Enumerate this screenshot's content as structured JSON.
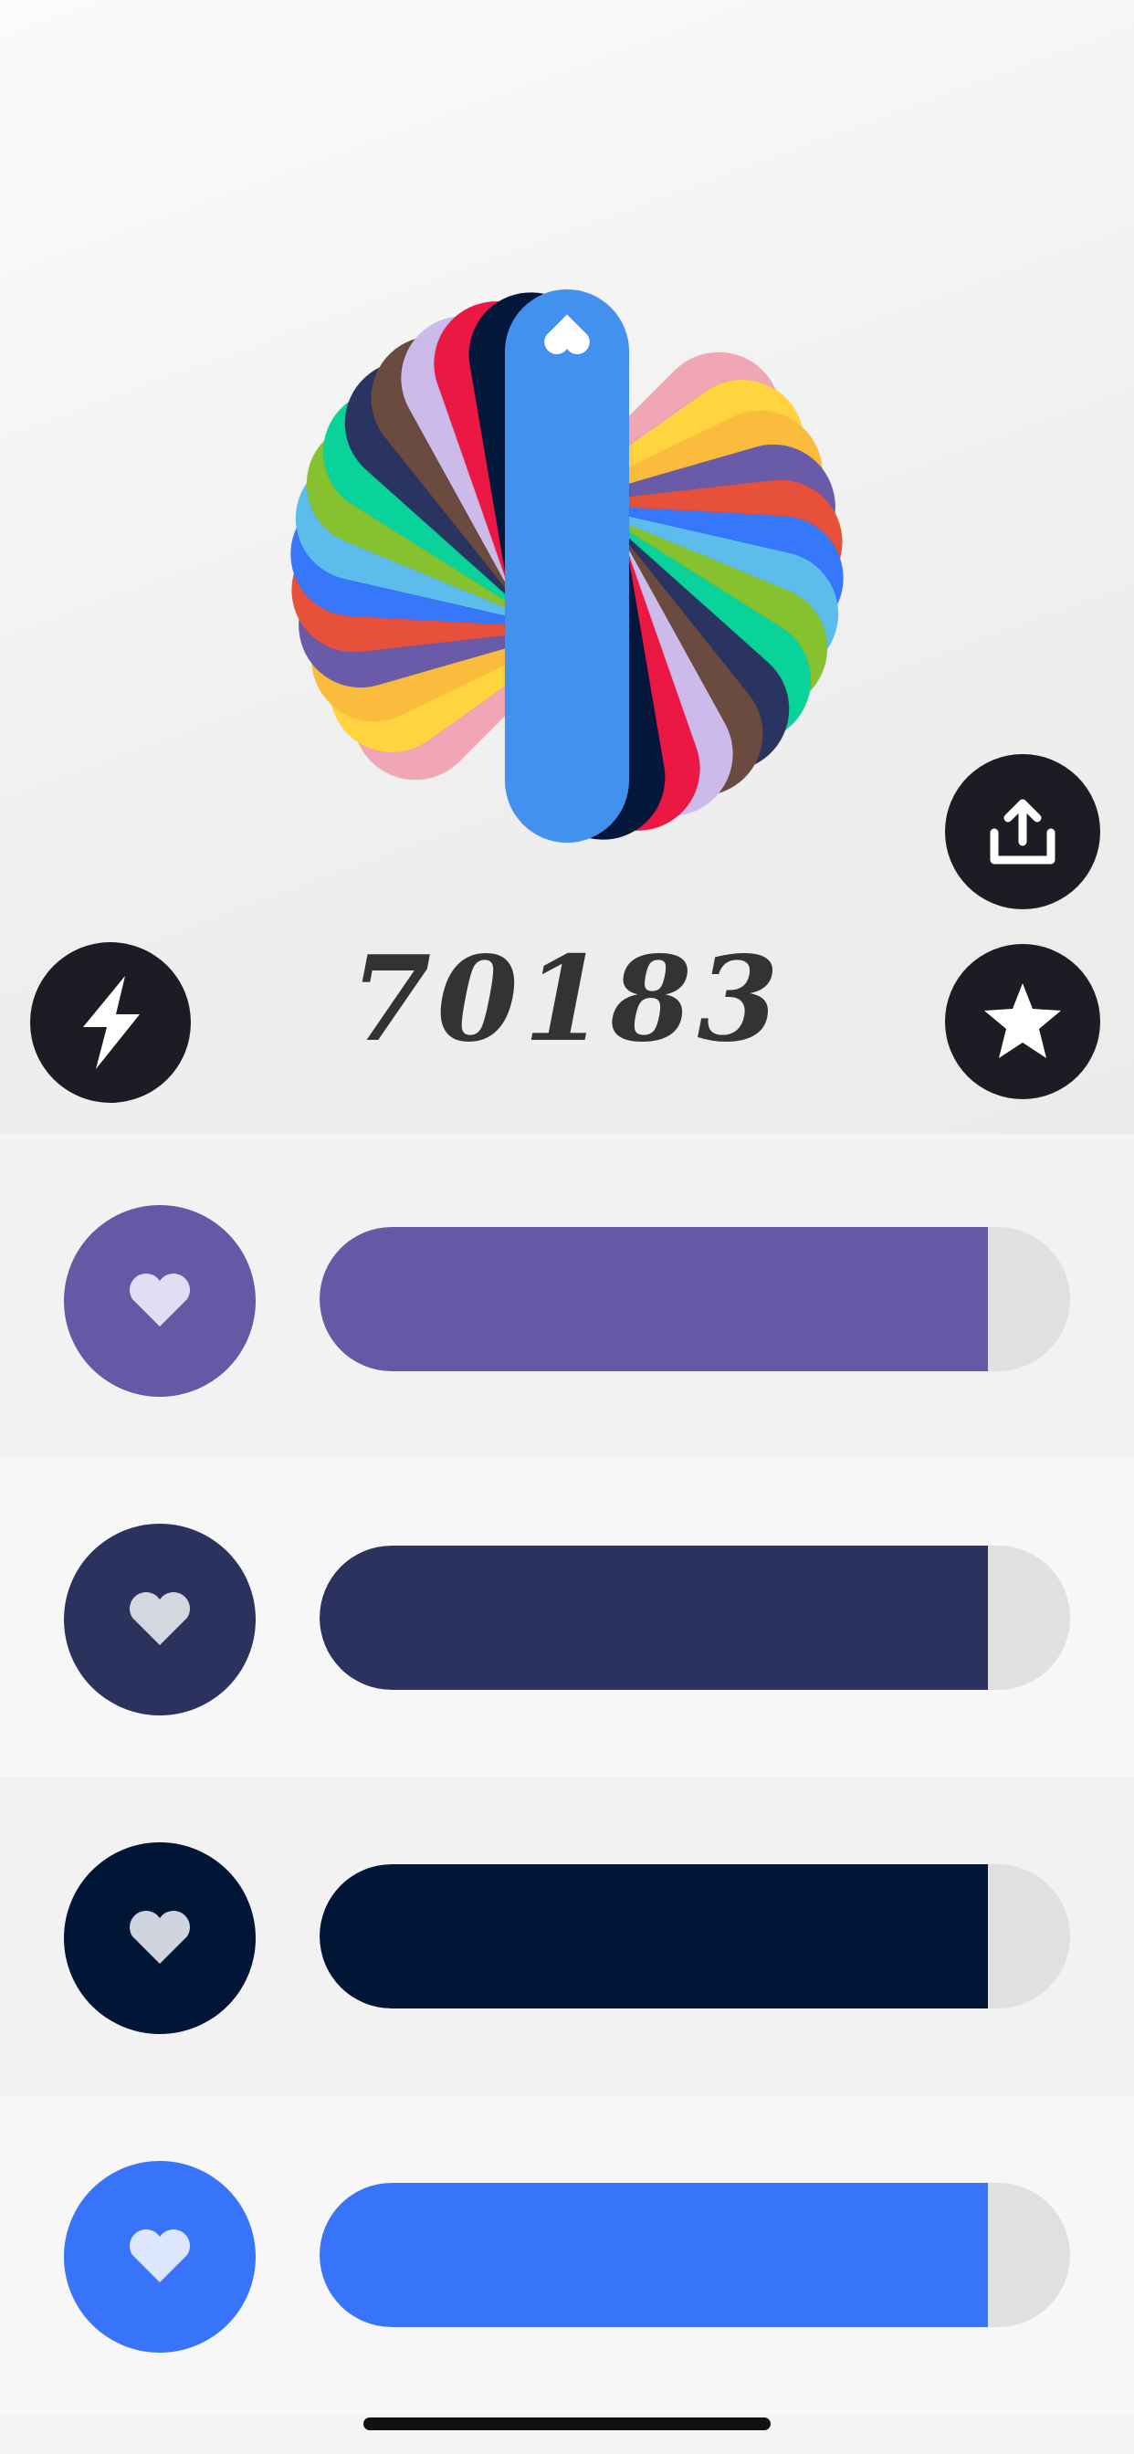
{
  "score": "70183",
  "fan_colors": [
    "#f1a6b6",
    "#ffd43e",
    "#fbbb3c",
    "#6a5ba9",
    "#e7503a",
    "#3777f9",
    "#5cbded",
    "#86c22f",
    "#09d39b",
    "#2a3460",
    "#6b4a3f",
    "#ccbaea",
    "#eb1844",
    "#02173a",
    "#4391ef"
  ],
  "buttons": {
    "share_icon": "share-icon",
    "bolt_icon": "lightning-icon",
    "star_icon": "star-icon"
  },
  "rows": [
    {
      "color": "#6559a6",
      "heart_tint": "#e2ddf2",
      "progress": 0.89,
      "icon": "heart-icon"
    },
    {
      "color": "#2a325d",
      "heart_tint": "#d5d7e0",
      "progress": 0.89,
      "icon": "heart-icon"
    },
    {
      "color": "#011536",
      "heart_tint": "#cfd4de",
      "progress": 0.89,
      "icon": "heart-icon"
    },
    {
      "color": "#3774fa",
      "heart_tint": "#dce6fe",
      "progress": 0.89,
      "icon": "heart-icon"
    }
  ]
}
